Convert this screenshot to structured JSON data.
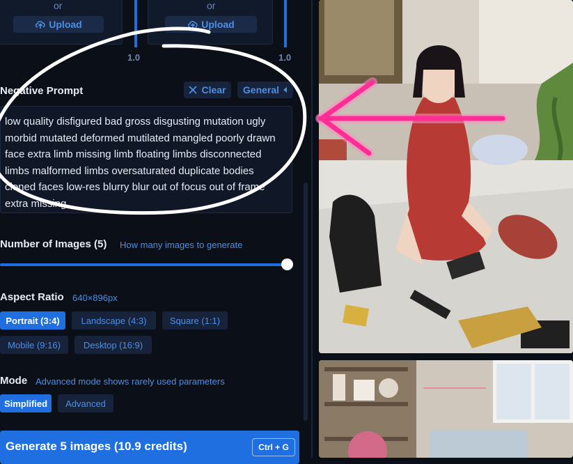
{
  "uploads": [
    {
      "or_label": "or",
      "button_label": "Upload",
      "scale_label": "1.0"
    },
    {
      "or_label": "or",
      "button_label": "Upload",
      "scale_label": "1.0"
    }
  ],
  "negative_prompt": {
    "label": "Negative Prompt",
    "clear_label": "Clear",
    "preset_label": "General",
    "text": "low quality disfigured bad gross disgusting mutation ugly morbid mutated deformed mutilated mangled poorly drawn face extra limb missing limb floating limbs disconnected limbs malformed limbs oversaturated duplicate bodies cloned faces low-res blurry blur out of focus out of frame extra missing"
  },
  "num_images": {
    "label": "Number of Images (5)",
    "hint": "How many images to generate",
    "value": 5,
    "fraction": 1.0
  },
  "aspect_ratio": {
    "label": "Aspect Ratio",
    "hint": "640×896px",
    "options": [
      "Portrait (3:4)",
      "Landscape (4:3)",
      "Square (1:1)",
      "Mobile (9:16)",
      "Desktop (16:9)"
    ],
    "selected": "Portrait (3:4)"
  },
  "mode": {
    "label": "Mode",
    "hint": "Advanced mode shows rarely used parameters",
    "options": [
      "Simplified",
      "Advanced"
    ],
    "selected": "Simplified"
  },
  "generate": {
    "label": "Generate 5 images (10.9 credits)",
    "shortcut": "Ctrl + G"
  },
  "colors": {
    "accent": "#1f6fe0",
    "annotation_circle": "#ffffff",
    "annotation_arrow": "#ff2d95"
  },
  "icons": [
    "upload-icon",
    "close-icon",
    "chevron-icon"
  ]
}
